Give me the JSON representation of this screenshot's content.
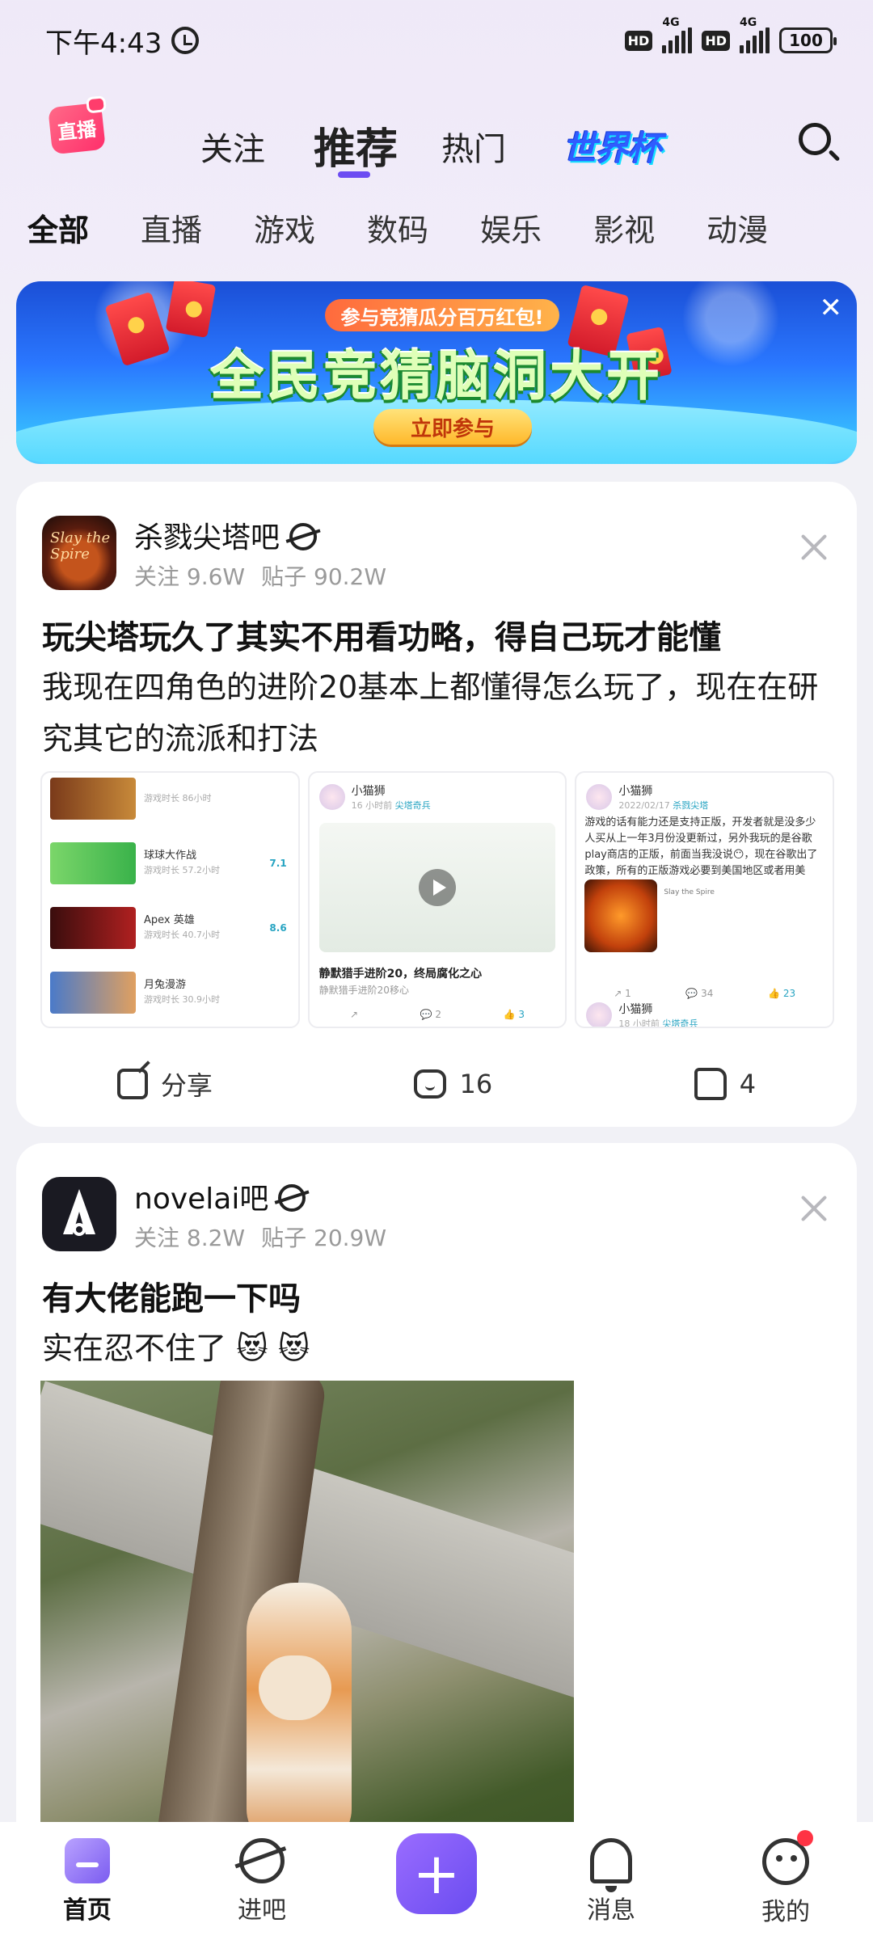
{
  "status": {
    "time": "下午4:43",
    "hd": "HD",
    "net": "4G",
    "battery": "100"
  },
  "topnav": {
    "live_logo": "直播",
    "tabs": [
      "关注",
      "推荐",
      "热门"
    ],
    "worldcup": "世界杯"
  },
  "categories": [
    "全部",
    "直播",
    "游戏",
    "数码",
    "娱乐",
    "影视",
    "动漫"
  ],
  "banner": {
    "subtitle": "参与竞猜瓜分百万红包!",
    "headline": "全民竞猜脑洞大开",
    "cta": "立即参与"
  },
  "posts": [
    {
      "forum": "杀戮尖塔吧",
      "avatar_text": "Slay the Spire",
      "follow": "关注 9.6W",
      "posts_count": "贴子 90.2W",
      "title": "玩尖塔玩久了其实不用看功略，得自己玩才能懂",
      "body": "我现在四角色的进阶20基本上都懂得怎么玩了，现在在研究其它的流派和打法",
      "thumb1": {
        "rows": [
          {
            "name": "球球大作战",
            "time": "游戏时长 57.2小时",
            "score": "7.1"
          },
          {
            "name": "Apex 英雄",
            "time": "游戏时长 40.7小时",
            "score": "8.6"
          },
          {
            "name": "月兔漫游",
            "time": "游戏时长 30.9小时",
            "score": ""
          }
        ]
      },
      "thumb2": {
        "user": "小猫狮",
        "time": "16 小时前",
        "tag": "尖塔奇兵",
        "title": "静默猎手进阶20，终局腐化之心",
        "sub": "静默猎手进阶20移心",
        "comments": "2",
        "likes": "3"
      },
      "thumb3": {
        "user": "小猫狮",
        "date": "2022/02/17",
        "tag": "杀戮尖塔",
        "text": "游戏的话有能力还是支持正版，开发者就是没多少人买从上一年3月份没更新过，另外我玩的是谷歌play商店的正版，前面当我没说😶，现在谷歌出了政策，所有的正版游戏必要到美国地区或者用美",
        "list": "Slay the Spire",
        "shares": "1",
        "comments": "34",
        "likes": "23",
        "user2": "小猫狮",
        "time2": "18 小时前",
        "tag2": "尖塔奇兵"
      },
      "actions": {
        "share": "分享",
        "comments": "16",
        "likes": "4"
      }
    },
    {
      "forum": "novelai吧",
      "follow": "关注 8.2W",
      "posts_count": "贴子 20.9W",
      "title": "有大佬能跑一下吗",
      "body": "实在忍不住了 😻 😻"
    }
  ],
  "bottomnav": [
    "首页",
    "进吧",
    "消息",
    "我的"
  ]
}
